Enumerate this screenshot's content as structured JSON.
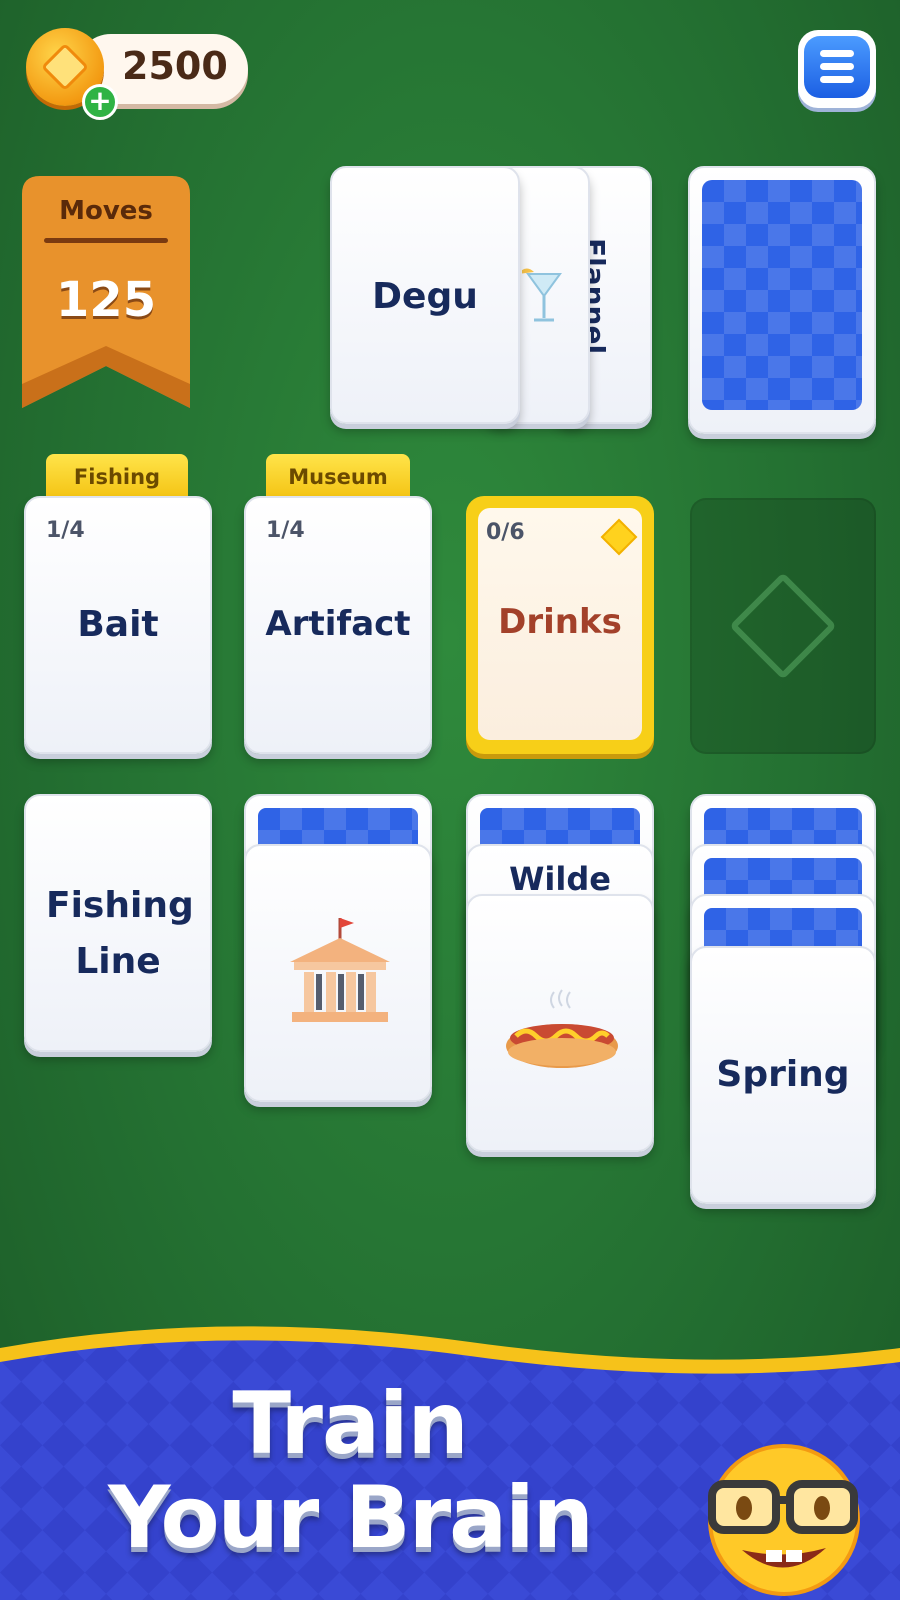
{
  "header": {
    "coins": "2500",
    "coin_icon": "coin-icon",
    "add_icon": "plus-icon",
    "menu_icon": "hamburger-menu-icon"
  },
  "moves": {
    "label": "Moves",
    "value": "125"
  },
  "draw_pile": {
    "top_card": "Degu",
    "middle_card_icon": "cocktail-glass-icon",
    "back_card": "Flannel"
  },
  "foundations": [
    {
      "tab": "Fishing",
      "count": "1/4",
      "word": "Bait"
    },
    {
      "tab": "Museum",
      "count": "1/4",
      "word": "Artifact"
    },
    {
      "tab": "",
      "count": "0/6",
      "word": "Drinks",
      "badge_icon": "diamond-icon"
    }
  ],
  "empty_slot_icon": "diamond-outline-icon",
  "tableau": [
    {
      "visible": "Fishing Line"
    },
    {
      "icon": "museum-building-icon"
    },
    {
      "peek": "Wilde",
      "icon": "hotdog-icon"
    },
    {
      "visible": "Spring"
    }
  ],
  "banner": {
    "line1": "Train",
    "line2": "Your Brain",
    "mascot_icon": "nerd-emoji-icon"
  },
  "colors": {
    "felt": "#247132",
    "card_back": "#2f63e6",
    "highlight": "#f7cf18",
    "banner": "#3340c9",
    "moves_ribbon": "#e8922c"
  }
}
